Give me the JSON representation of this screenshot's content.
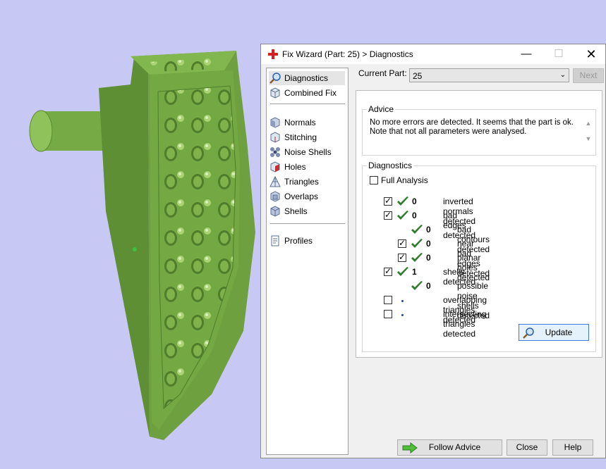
{
  "dialog": {
    "title": "Fix Wizard (Part: 25) > Diagnostics",
    "icons": {
      "app": "red-cross-icon",
      "minimize": "minimize-icon",
      "maximize": "maximize-icon",
      "close": "close-icon"
    }
  },
  "sidebar": {
    "group1": [
      {
        "label": "Diagnostics",
        "icon": "magnifier-icon",
        "selected": true
      },
      {
        "label": "Combined Fix",
        "icon": "cube-icon"
      }
    ],
    "group2": [
      {
        "label": "Normals",
        "icon": "normals-cube-icon"
      },
      {
        "label": "Stitching",
        "icon": "stitching-cube-icon"
      },
      {
        "label": "Noise Shells",
        "icon": "noise-shells-icon"
      },
      {
        "label": "Holes",
        "icon": "holes-cube-icon"
      },
      {
        "label": "Triangles",
        "icon": "triangles-icon"
      },
      {
        "label": "Overlaps",
        "icon": "overlaps-cube-icon"
      },
      {
        "label": "Shells",
        "icon": "shells-cube-icon"
      }
    ],
    "group3": [
      {
        "label": "Profiles",
        "icon": "profiles-document-icon"
      }
    ]
  },
  "header": {
    "current_part_label": "Current Part:",
    "current_part_value": "25",
    "next_label": "Next"
  },
  "advice": {
    "title": "Advice",
    "line1": "No more errors are detected. It seems that the part is ok.",
    "line2": "Note that not all parameters were analysed."
  },
  "diagnostics": {
    "title": "Diagnostics",
    "full_analysis_label": "Full Analysis",
    "full_analysis_checked": false,
    "rows": [
      {
        "checkbox": true,
        "checked": true,
        "status": "ok",
        "count": "0",
        "label": "inverted normals detected",
        "indent": 0
      },
      {
        "checkbox": true,
        "checked": true,
        "status": "ok",
        "count": "0",
        "label": "bad edges detected",
        "indent": 0
      },
      {
        "checkbox": false,
        "checked": false,
        "status": "ok",
        "count": "0",
        "label": "bad contours detected",
        "indent": 1
      },
      {
        "checkbox": true,
        "checked": true,
        "status": "ok",
        "count": "0",
        "label": "near bad edges detected",
        "indent": 1
      },
      {
        "checkbox": true,
        "checked": true,
        "status": "ok",
        "count": "0",
        "label": "planar holes detected",
        "indent": 1
      },
      {
        "checkbox": true,
        "checked": true,
        "status": "ok",
        "count": "1",
        "label": "shells detected",
        "indent": 0
      },
      {
        "checkbox": false,
        "checked": false,
        "status": "ok",
        "count": "0",
        "label": "possible noise shells detected",
        "indent": 1
      },
      {
        "checkbox": true,
        "checked": false,
        "status": "none",
        "count": "",
        "label": "overlapping triangles detected",
        "indent": 0
      },
      {
        "checkbox": true,
        "checked": false,
        "status": "none",
        "count": "",
        "label": "intersecting triangles detected",
        "indent": 0
      }
    ],
    "update_label": "Update"
  },
  "footer": {
    "follow_advice_label": "Follow Advice",
    "close_label": "Close",
    "help_label": "Help"
  },
  "colors": {
    "background": "#c8c8f4",
    "model": "#6fa03f",
    "check": "#2e7d2e"
  }
}
